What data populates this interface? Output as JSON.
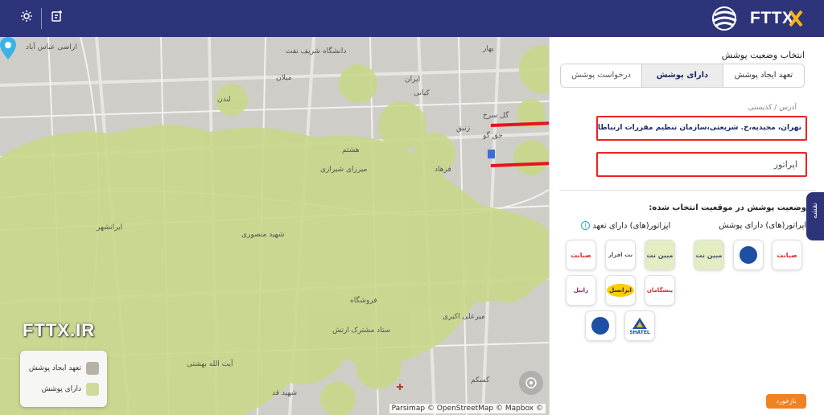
{
  "topbar": {
    "logo_text": "FTTX",
    "icons": [
      "settings-icon",
      "add-note-icon"
    ],
    "bg_color": "#2d3479"
  },
  "map": {
    "labels": [
      {
        "text": "اراضی عباس آباد"
      },
      {
        "text": "دانشگاه شریف نفت"
      },
      {
        "text": "میلان"
      },
      {
        "text": "ایران"
      },
      {
        "text": "کیانی"
      },
      {
        "text": "لندن"
      },
      {
        "text": "بهار"
      },
      {
        "text": "گل سرخ"
      },
      {
        "text": "زنبق"
      },
      {
        "text": "حق گو"
      },
      {
        "text": "هشتم"
      },
      {
        "text": "فرهاد"
      },
      {
        "text": "میرزای شیرازی"
      },
      {
        "text": "شهید منصوری"
      },
      {
        "text": "ستاد مشترک ارتش"
      },
      {
        "text": "فروشگاه"
      },
      {
        "text": "میرعلی اکبری"
      },
      {
        "text": "کسکم"
      },
      {
        "text": "شهید قد"
      },
      {
        "text": "آیت الله بهشتی"
      },
      {
        "text": "ایرانشهر"
      }
    ],
    "watermark": "FTTX.IR",
    "legend": {
      "items": [
        {
          "label": "تعهد ایجاد پوشش",
          "color": "#b7b1a8"
        },
        {
          "label": "دارای پوشش",
          "color": "#cfdb9a"
        }
      ]
    },
    "attribution": "Parsimap © OpenStreetMap © Mapbox ©",
    "coverage_color": "#c9d88a"
  },
  "panel": {
    "section_title": "انتخاب وضعیت پوشش",
    "tabs": [
      {
        "label": "تعهد ایجاد پوشش",
        "active": false
      },
      {
        "label": "دارای پوشش",
        "active": true
      },
      {
        "label": "درخواست پوشش",
        "active": false
      }
    ],
    "address_label": "آدرس / کدپستی",
    "address_value": "تهران، مجیدیه،خ. شریعتی،سازمان تنظیم مقررات ارتباطات رادیویی",
    "operator_placeholder": "اپراتور",
    "status_title": "وضعیت پوشش در موقعیت انتخاب شده:",
    "covered_heading": "اپراتور(های) دارای پوشش",
    "committed_heading": "اپراتور(های) دارای تعهد",
    "covered_operators": [
      {
        "name": "صبانت",
        "icon": "sabanet-logo-icon"
      },
      {
        "name": "مخابرات",
        "icon": "mokhaberat-logo-icon"
      },
      {
        "name": "مبین نت",
        "icon": "mobinnet-logo-icon"
      }
    ],
    "committed_operators": [
      {
        "name": "صبانت",
        "icon": "sabanet-logo-icon"
      },
      {
        "name": "نت افزار",
        "icon": "netafzar-logo-icon"
      },
      {
        "name": "مبین نت",
        "icon": "mobinnet-logo-icon"
      },
      {
        "name": "رایتل",
        "icon": "rightel-logo-icon"
      },
      {
        "name": "ایرانسل",
        "icon": "irancell-logo-icon"
      },
      {
        "name": "پیشگامان",
        "icon": "pishgaman-logo-icon"
      },
      {
        "name": "SHATEL",
        "icon": "shatel-logo-icon"
      },
      {
        "name": "مخابرات",
        "icon": "mokhaberat-logo-icon"
      }
    ],
    "side_tab_label": "نقشه",
    "feedback_label": "بازخورد"
  }
}
